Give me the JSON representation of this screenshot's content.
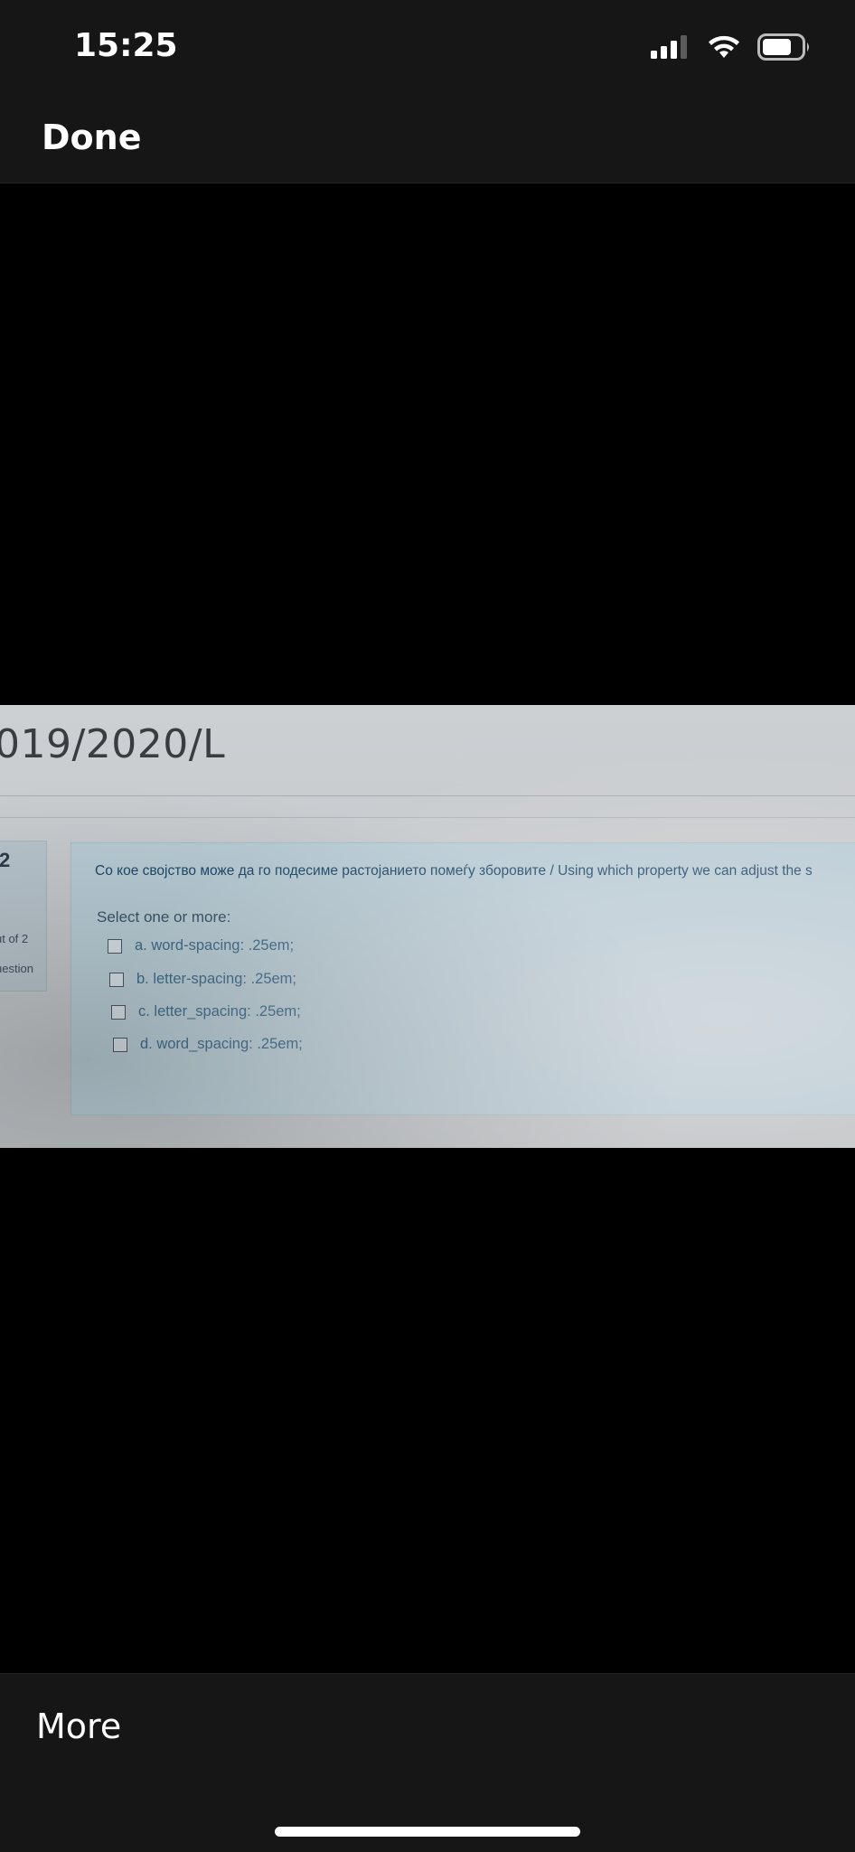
{
  "status_bar": {
    "time": "15:25",
    "signal_icon": "signal-bars-icon",
    "wifi_icon": "wifi-icon",
    "battery_icon": "battery-icon"
  },
  "nav": {
    "done_label": "Done"
  },
  "photo": {
    "course_title": "019/2020/L",
    "question_number": "2",
    "question_mark": "ut of 2",
    "question_flag": "uestion",
    "question_text": "Со кое својство може да го подесиме растојанието помеѓу зборовите / Using which property we can adjust the s",
    "prompt": "Select one or more:",
    "options": [
      "a. word-spacing: .25em;",
      "b. letter-spacing: .25em;",
      "c. letter_spacing: .25em;",
      "d. word_spacing: .25em;"
    ]
  },
  "bottom": {
    "more_label": "More"
  },
  "colors": {
    "bar_bg": "#161616",
    "viewer_bg": "#000000",
    "question_box": "#b9cdd6",
    "link_blue": "#3d6c8c"
  }
}
